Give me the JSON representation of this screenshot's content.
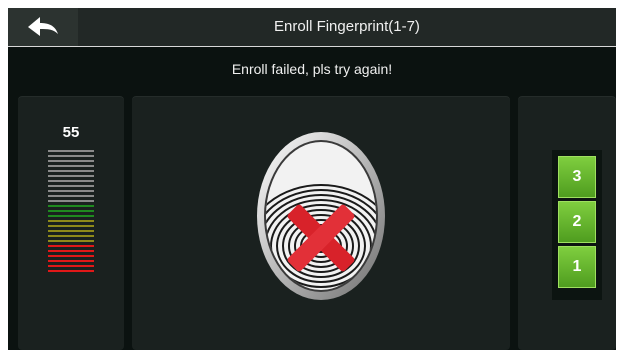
{
  "header": {
    "title": "Enroll Fingerprint(1-7)",
    "back_icon": "back-arrow-icon"
  },
  "status_message": "Enroll failed, pls try again!",
  "quality": {
    "value": "55",
    "levels": [
      "#8a8a8a",
      "#8a8a8a",
      "#8a8a8a",
      "#8a8a8a",
      "#8a8a8a",
      "#8a8a8a",
      "#8a8a8a",
      "#8a8a8a",
      "#8a8a8a",
      "#8a8a8a",
      "#8a8a8a",
      "#1f8a1f",
      "#1f8a1f",
      "#1f8a1f",
      "#8f8a1a",
      "#8f8a1a",
      "#8f8a1a",
      "#8f8a1a",
      "#8f8a1a",
      "#e01818",
      "#e01818",
      "#e01818",
      "#e01818",
      "#e01818",
      "#e01818"
    ]
  },
  "fingerprint": {
    "icon": "fingerprint-failed-icon",
    "result": "failed"
  },
  "steps": [
    "3",
    "2",
    "1"
  ]
}
